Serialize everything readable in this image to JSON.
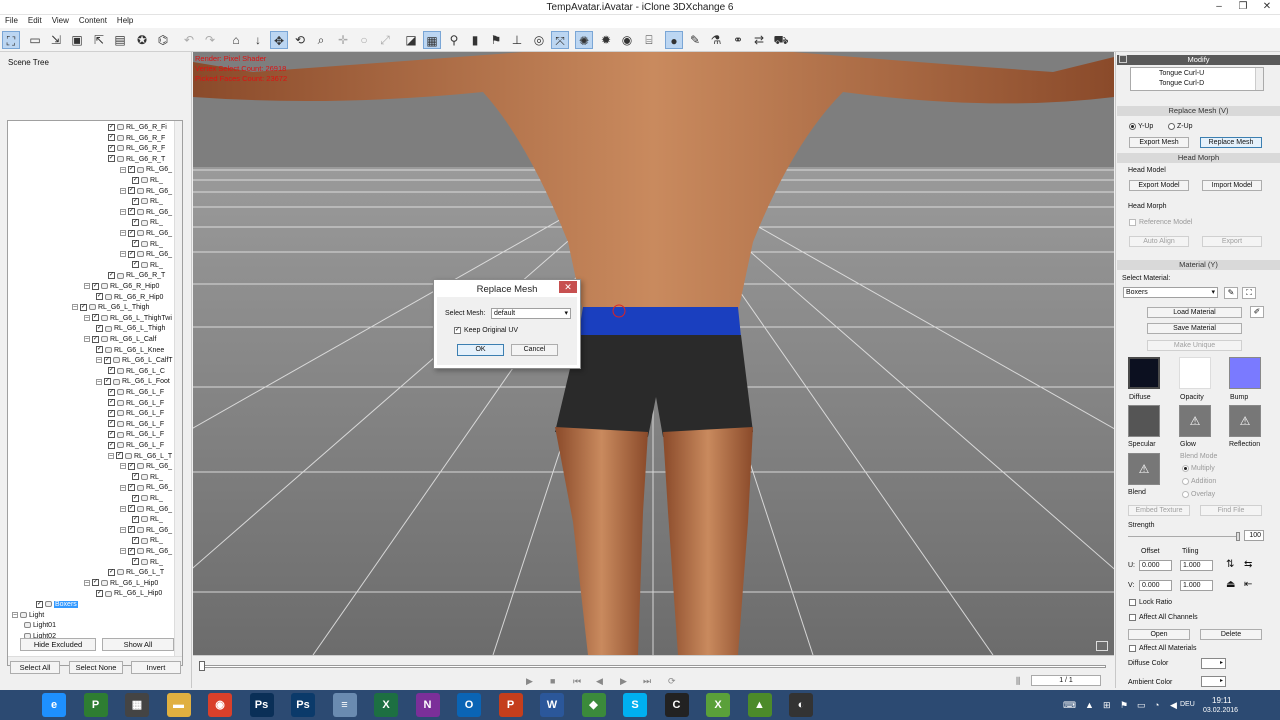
{
  "window": {
    "title": "TempAvatar.iAvatar - iClone 3DXchange 6",
    "controls": [
      "–",
      "❐",
      "✕"
    ]
  },
  "menu": [
    "File",
    "Edit",
    "View",
    "Content",
    "Help"
  ],
  "scene_tree": {
    "title": "Scene Tree",
    "nodes": [
      {
        "label": "RL_G6_R_Fi",
        "depth": 8,
        "expand": false
      },
      {
        "label": "RL_G6_R_F",
        "depth": 8,
        "expand": false
      },
      {
        "label": "RL_G6_R_F",
        "depth": 8,
        "expand": false
      },
      {
        "label": "RL_G6_R_T",
        "depth": 8,
        "expand": false
      },
      {
        "label": "RL_G6_",
        "depth": 9,
        "expand": true
      },
      {
        "label": "RL_",
        "depth": 10,
        "expand": false
      },
      {
        "label": "RL_G6_",
        "depth": 9,
        "expand": true
      },
      {
        "label": "RL_",
        "depth": 10,
        "expand": false
      },
      {
        "label": "RL_G6_",
        "depth": 9,
        "expand": true
      },
      {
        "label": "RL_",
        "depth": 10,
        "expand": false
      },
      {
        "label": "RL_G6_",
        "depth": 9,
        "expand": true
      },
      {
        "label": "RL_",
        "depth": 10,
        "expand": false
      },
      {
        "label": "RL_G6_",
        "depth": 9,
        "expand": true
      },
      {
        "label": "RL_",
        "depth": 10,
        "expand": false
      },
      {
        "label": "RL_G6_R_T",
        "depth": 8,
        "expand": false
      },
      {
        "label": "RL_G6_R_Hip0",
        "depth": 6,
        "expand": true
      },
      {
        "label": "RL_G6_R_Hip0",
        "depth": 7,
        "expand": false
      },
      {
        "label": "RL_G6_L_Thigh",
        "depth": 5,
        "expand": true
      },
      {
        "label": "RL_G6_L_ThighTwi",
        "depth": 6,
        "expand": true
      },
      {
        "label": "RL_G6_L_Thigh",
        "depth": 7,
        "expand": false
      },
      {
        "label": "RL_G6_L_Calf",
        "depth": 6,
        "expand": true
      },
      {
        "label": "RL_G6_L_Knee",
        "depth": 7,
        "expand": false
      },
      {
        "label": "RL_G6_L_CalfT",
        "depth": 7,
        "expand": true
      },
      {
        "label": "RL_G6_L_C",
        "depth": 8,
        "expand": false
      },
      {
        "label": "RL_G6_L_Foot",
        "depth": 7,
        "expand": true
      },
      {
        "label": "RL_G6_L_F",
        "depth": 8,
        "expand": false
      },
      {
        "label": "RL_G6_L_F",
        "depth": 8,
        "expand": false
      },
      {
        "label": "RL_G6_L_F",
        "depth": 8,
        "expand": false
      },
      {
        "label": "RL_G6_L_F",
        "depth": 8,
        "expand": false
      },
      {
        "label": "RL_G6_L_F",
        "depth": 8,
        "expand": false
      },
      {
        "label": "RL_G6_L_F",
        "depth": 8,
        "expand": false
      },
      {
        "label": "RL_G6_L_T",
        "depth": 8,
        "expand": true
      },
      {
        "label": "RL_G6_",
        "depth": 9,
        "expand": true
      },
      {
        "label": "RL_",
        "depth": 10,
        "expand": false
      },
      {
        "label": "RL_G6_",
        "depth": 9,
        "expand": true
      },
      {
        "label": "RL_",
        "depth": 10,
        "expand": false
      },
      {
        "label": "RL_G6_",
        "depth": 9,
        "expand": true
      },
      {
        "label": "RL_",
        "depth": 10,
        "expand": false
      },
      {
        "label": "RL_G6_",
        "depth": 9,
        "expand": true
      },
      {
        "label": "RL_",
        "depth": 10,
        "expand": false
      },
      {
        "label": "RL_G6_",
        "depth": 9,
        "expand": true
      },
      {
        "label": "RL_",
        "depth": 10,
        "expand": false
      },
      {
        "label": "RL_G6_L_T",
        "depth": 8,
        "expand": false
      },
      {
        "label": "RL_G6_L_Hip0",
        "depth": 6,
        "expand": true
      },
      {
        "label": "RL_G6_L_Hip0",
        "depth": 7,
        "expand": false
      },
      {
        "label": "Boxers",
        "depth": 2,
        "expand": false,
        "selected": true
      },
      {
        "label": "Light",
        "depth": 0,
        "expand": true,
        "nocheck": true
      },
      {
        "label": "Light01",
        "depth": 1,
        "expand": false,
        "nocheck": true
      },
      {
        "label": "Light02",
        "depth": 1,
        "expand": false,
        "nocheck": true
      },
      {
        "label": "Light03",
        "depth": 1,
        "expand": false,
        "nocheck": true
      }
    ],
    "buttons": {
      "hide_excluded": "Hide Excluded",
      "show_all": "Show All",
      "select_all": "Select All",
      "select_none": "Select None",
      "invert": "Invert"
    }
  },
  "viewport": {
    "info_lines": [
      "Render: Pixel Shader",
      "Vertex Select Count: 26918",
      "Picked Faces Count: 23672"
    ]
  },
  "timeline": {
    "frame": "1 / 1"
  },
  "dialog": {
    "title": "Replace Mesh",
    "select_mesh_label": "Select Mesh:",
    "select_mesh_value": "default",
    "keep_uv_label": "Keep Original UV",
    "keep_uv_checked": true,
    "ok": "OK",
    "cancel": "Cancel"
  },
  "panel": {
    "title": "Modify",
    "morph_list": [
      "Tongue Curl-U",
      "Tongue Curl-D"
    ],
    "replace_mesh": {
      "header": "Replace Mesh  (V)",
      "y_up": "Y-Up",
      "z_up": "Z-Up",
      "export": "Export Mesh",
      "replace": "Replace Mesh"
    },
    "head_morph": {
      "header": "Head Morph",
      "head_model": "Head Model",
      "export_model": "Export Model",
      "import_model": "Import Model",
      "head_morph_label": "Head Morph",
      "reference_model": "Reference Model",
      "auto_align": "Auto Align",
      "export": "Export"
    },
    "material": {
      "header": "Material  (Y)",
      "select_label": "Select Material:",
      "selected": "Boxers",
      "load": "Load Material",
      "save": "Save Material",
      "make_unique": "Make Unique",
      "channels": [
        "Diffuse",
        "Opacity",
        "Bump",
        "Specular",
        "Glow",
        "Reflection",
        "Blend"
      ],
      "blend_mode": "Blend Mode",
      "blend_options": [
        "Multiply",
        "Addition",
        "Overlay"
      ],
      "embed_texture": "Embed Texture",
      "find_file": "Find File",
      "strength": "Strength",
      "strength_value": "100",
      "offset": "Offset",
      "tiling": "Tiling",
      "u_label": "U:",
      "v_label": "V:",
      "u_offset": "0.000",
      "u_tiling": "1.000",
      "v_offset": "0.000",
      "v_tiling": "1.000",
      "lock_ratio": "Lock Ratio",
      "affect_all_channels": "Affect All Channels",
      "open": "Open",
      "delete": "Delete",
      "affect_all_materials": "Affect All Materials",
      "diffuse_color": "Diffuse Color",
      "ambient_color": "Ambient Color"
    }
  },
  "taskbar": {
    "apps": [
      {
        "name": "ie-icon",
        "glyph": "e",
        "color": "#1e90ff"
      },
      {
        "name": "project-icon",
        "glyph": "P",
        "color": "#2e7d32"
      },
      {
        "name": "calculator-icon",
        "glyph": "▦",
        "color": "#444"
      },
      {
        "name": "explorer-icon",
        "glyph": "▬",
        "color": "#e0b040"
      },
      {
        "name": "chrome-icon",
        "glyph": "◉",
        "color": "#d9402b"
      },
      {
        "name": "photoshop-icon",
        "glyph": "Ps",
        "color": "#0a2f57"
      },
      {
        "name": "photoshop2-icon",
        "glyph": "Ps",
        "color": "#0b3a6a"
      },
      {
        "name": "notepad-icon",
        "glyph": "≡",
        "color": "#6a8bb0"
      },
      {
        "name": "excel-icon",
        "glyph": "X",
        "color": "#1d6f42"
      },
      {
        "name": "onenote-icon",
        "glyph": "N",
        "color": "#7b2f99"
      },
      {
        "name": "outlook-icon",
        "glyph": "O",
        "color": "#0a64b5"
      },
      {
        "name": "powerpoint-icon",
        "glyph": "P",
        "color": "#c43e1c"
      },
      {
        "name": "word-icon",
        "glyph": "W",
        "color": "#2b579a"
      },
      {
        "name": "android-icon",
        "glyph": "◆",
        "color": "#3b8a3b"
      },
      {
        "name": "skype-icon",
        "glyph": "S",
        "color": "#00aff0"
      },
      {
        "name": "character-creator-icon",
        "glyph": "C",
        "color": "#222"
      },
      {
        "name": "3dxchange-icon",
        "glyph": "X",
        "color": "#5aa03a"
      },
      {
        "name": "iclone-icon",
        "glyph": "▲",
        "color": "#4c8a2a"
      },
      {
        "name": "obs-icon",
        "glyph": "◐",
        "color": "#333"
      }
    ],
    "lang": "DEU",
    "time": "19:11",
    "date": "03.02.2016"
  }
}
